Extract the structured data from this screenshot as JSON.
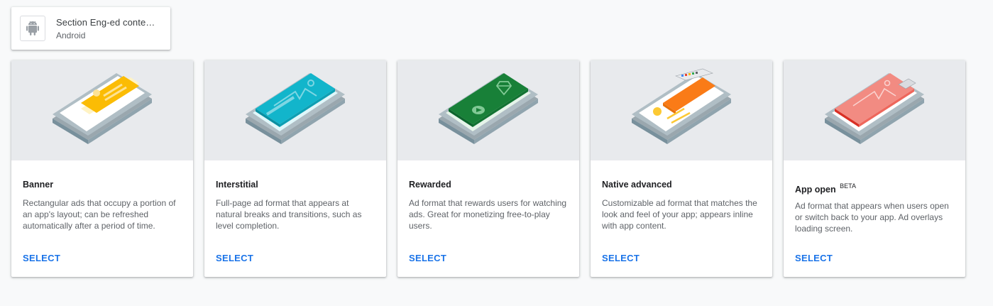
{
  "app": {
    "name": "Section Eng-ed conte…",
    "platform": "Android",
    "icon": "android-icon"
  },
  "cards": [
    {
      "title": "Banner",
      "badge": "",
      "description": "Rectangular ads that occupy a portion of an app's layout; can be refreshed automatically after a period of time.",
      "action": "SELECT",
      "accent": "#fbbc04"
    },
    {
      "title": "Interstitial",
      "badge": "",
      "description": "Full-page ad format that appears at natural breaks and transitions, such as level completion.",
      "action": "SELECT",
      "accent": "#12b5cb"
    },
    {
      "title": "Rewarded",
      "badge": "",
      "description": "Ad format that rewards users for watching ads. Great for monetizing free-to-play users.",
      "action": "SELECT",
      "accent": "#188038"
    },
    {
      "title": "Native advanced",
      "badge": "",
      "description": "Customizable ad format that matches the look and feel of your app; appears inline with app content.",
      "action": "SELECT",
      "accent": "#fa7b17"
    },
    {
      "title": "App open",
      "badge": "BETA",
      "description": "Ad format that appears when users open or switch back to your app. Ad overlays loading screen.",
      "action": "SELECT",
      "accent": "#ee675c"
    }
  ],
  "colors": {
    "link": "#1a73e8",
    "hero_bg": "#e8eaed",
    "page_bg": "#f8f9fa"
  }
}
